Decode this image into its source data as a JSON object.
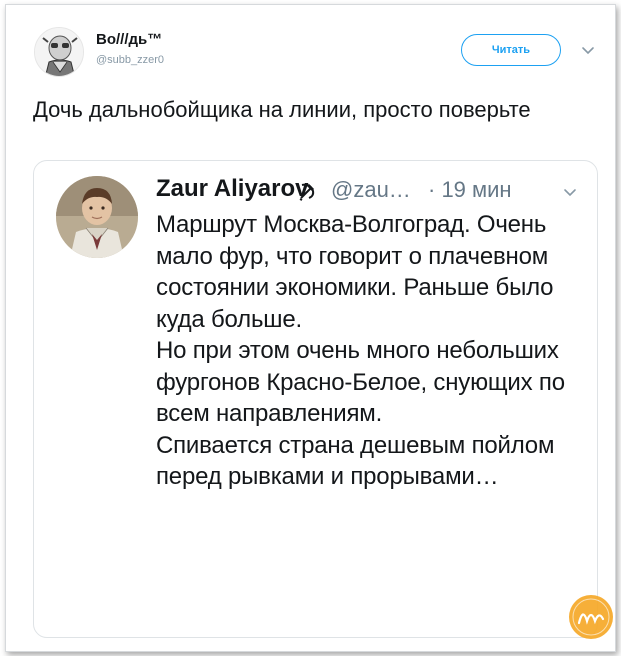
{
  "author": {
    "name": "Bo///дь™",
    "handle": "@subb_zzer0",
    "avatar_icon": "aviator-avatar-icon"
  },
  "follow_button": {
    "label": "Читать"
  },
  "tweet": {
    "text": "Дочь дальнобойщика на линии, просто поверьте"
  },
  "quote": {
    "name": "Zaur Aliyarov",
    "badge_icon": "hammer-sickle-icon",
    "handle": "@zau…",
    "time": "· 19 мин",
    "avatar_icon": "child-photo-avatar",
    "paragraphs": [
      "Маршрут Москва-Волгоград. Очень мало фур, что говорит о плачевном состоянии экономики. Раньше было куда больше.",
      "Но при этом очень много небольших фургонов Красно-Белое, снующих по всем направлениям.",
      "Спивается страна дешевым пойлом перед рывками и прорывами…"
    ]
  },
  "colors": {
    "accent": "#1da1f2",
    "text": "#14171a",
    "muted": "#657786",
    "watermark": "#f5a623"
  }
}
